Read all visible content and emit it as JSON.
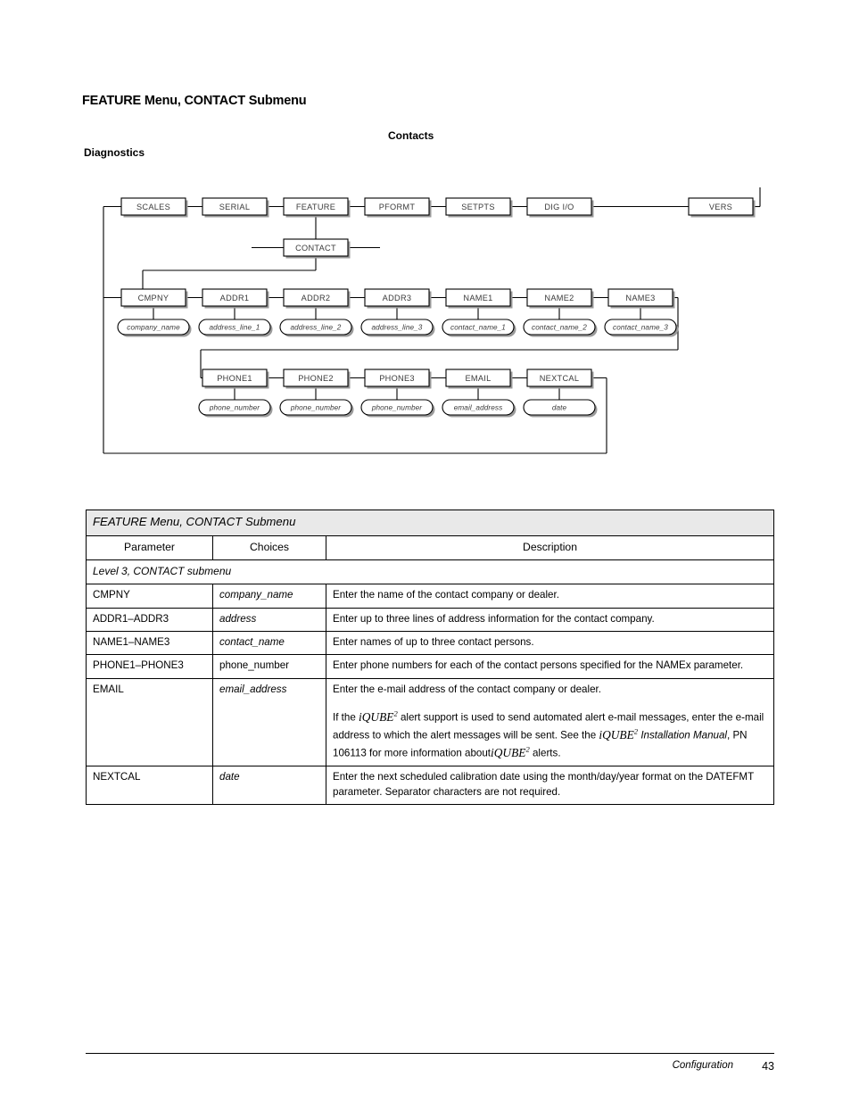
{
  "page": {
    "title": "FEATURE Menu, CONTACT Submenu",
    "label_contacts": "Contacts",
    "label_diagnostics": "Diagnostics"
  },
  "diagram": {
    "top_row": [
      {
        "label": "SCALES"
      },
      {
        "label": "SERIAL"
      },
      {
        "label": "FEATURE"
      },
      {
        "label": "PFORMT"
      },
      {
        "label": "SETPTS"
      },
      {
        "label": "DIG I/O"
      },
      {
        "label": "VERS"
      }
    ],
    "submenu_box": {
      "label": "CONTACT"
    },
    "row2": [
      {
        "label": "CMPNY",
        "value": "company_name"
      },
      {
        "label": "ADDR1",
        "value": "address_line_1"
      },
      {
        "label": "ADDR2",
        "value": "address_line_2"
      },
      {
        "label": "ADDR3",
        "value": "address_line_3"
      },
      {
        "label": "NAME1",
        "value": "contact_name_1"
      },
      {
        "label": "NAME2",
        "value": "contact_name_2"
      },
      {
        "label": "NAME3",
        "value": "contact_name_3"
      }
    ],
    "row3": [
      {
        "label": "PHONE1",
        "value": "phone_number"
      },
      {
        "label": "PHONE2",
        "value": "phone_number"
      },
      {
        "label": "PHONE3",
        "value": "phone_number"
      },
      {
        "label": "EMAIL",
        "value": "email_address"
      },
      {
        "label": "NEXTCAL",
        "value": "date"
      }
    ]
  },
  "table": {
    "caption": "FEATURE Menu, CONTACT Submenu",
    "headers": {
      "parameter": "Parameter",
      "choices": "Choices",
      "description": "Description"
    },
    "section": "Level 3, CONTACT submenu",
    "rows": [
      {
        "parameter": "CMPNY",
        "choices": "company_name",
        "choices_italic": true,
        "description": "Enter the name of the contact company or dealer."
      },
      {
        "parameter": "ADDR1–ADDR3",
        "choices": "address",
        "choices_italic": true,
        "description": "Enter up to three lines of address information for the contact company."
      },
      {
        "parameter": "NAME1–NAME3",
        "choices": "contact_name",
        "choices_italic": true,
        "description": "Enter names of up to three contact persons."
      },
      {
        "parameter": "PHONE1–PHONE3",
        "choices": "phone_number",
        "choices_italic": false,
        "description": "Enter phone numbers for each of the contact persons specified for the NAMEx parameter."
      },
      {
        "parameter": "EMAIL",
        "choices": "email_address",
        "choices_italic": true,
        "description_p1": "Enter the e-mail address of the contact company or dealer.",
        "description_p2_a": "If the ",
        "description_p2_iqube1": "iQUBE",
        "description_p2_sup1": "2",
        "description_p2_b": " alert support is used to send automated alert e-mail messages, enter the e-mail address to which the alert messages will be sent. See the ",
        "description_p2_iqube2": "iQUBE",
        "description_p2_sup2": "2",
        "description_p2_manual": " Installation Manual",
        "description_p2_c": ", PN 106113 for more information about",
        "description_p2_iqube3": "iQUBE",
        "description_p2_sup3": "2",
        "description_p2_d": " alerts."
      },
      {
        "parameter": "NEXTCAL",
        "choices": "date",
        "choices_italic": true,
        "description": "Enter the next scheduled calibration date using the month/day/year format on the DATEFMT parameter. Separator characters are not required."
      }
    ]
  },
  "footer": {
    "chapter": "Configuration",
    "page_number": "43"
  }
}
